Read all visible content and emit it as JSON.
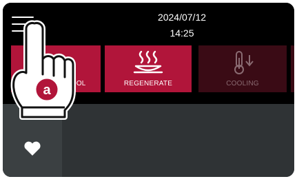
{
  "header": {
    "date": "2024/07/12",
    "time": "14:25",
    "menu_icon": "hamburger-menu-icon"
  },
  "modes": [
    {
      "label": "COOL",
      "icon": "snowflake-icon",
      "state": "active"
    },
    {
      "label": "REGENERATE",
      "icon": "steam-dish-icon",
      "state": "active"
    },
    {
      "label": "COOLING",
      "icon": "thermometer-down-icon",
      "state": "dimmed"
    }
  ],
  "sidebar": {
    "icon": "heart-icon"
  },
  "overlay": {
    "badge": "a",
    "icon": "pointing-hand-icon"
  },
  "colors": {
    "background": "#000000",
    "accent": "#b1153a",
    "accent_dim": "#3a0b15",
    "panel": "#2f3335",
    "badge": "#b1153a"
  }
}
